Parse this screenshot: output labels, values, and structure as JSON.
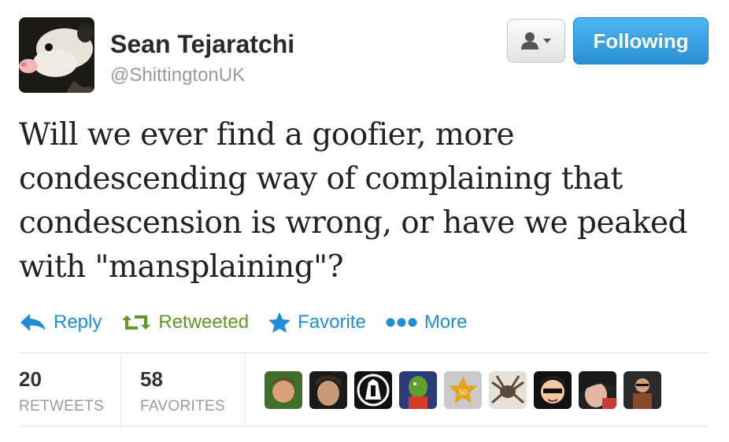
{
  "author": {
    "name": "Sean Tejaratchi",
    "handle": "@ShittingtonUK"
  },
  "follow_button": {
    "label": "Following"
  },
  "user_menu": {
    "icon": "person-dropdown-icon"
  },
  "tweet": {
    "lines": [
      "Will we ever find a goofier, more",
      "condescending way of complaining that",
      "condescension is wrong, or have we peaked",
      "with \"mansplaining\"?"
    ]
  },
  "actions": {
    "reply": {
      "label": "Reply",
      "icon": "reply-arrow-icon",
      "color": "#1f8ed8"
    },
    "retweet": {
      "label": "Retweeted",
      "icon": "retweet-icon",
      "color": "#609927"
    },
    "favorite": {
      "label": "Favorite",
      "icon": "star-icon",
      "color": "#1f8ed8"
    },
    "more": {
      "label": "More",
      "icon": "ellipsis-icon",
      "color": "#1f8ed8"
    }
  },
  "stats": {
    "retweets": {
      "count": "20",
      "label": "RETWEETS"
    },
    "favorites": {
      "count": "58",
      "label": "FAVORITES"
    }
  },
  "favoriters": [
    {
      "icon": "user-avatar-1"
    },
    {
      "icon": "user-avatar-2"
    },
    {
      "icon": "user-avatar-3"
    },
    {
      "icon": "user-avatar-4"
    },
    {
      "icon": "user-avatar-5"
    },
    {
      "icon": "user-avatar-6"
    },
    {
      "icon": "user-avatar-7"
    },
    {
      "icon": "user-avatar-8"
    },
    {
      "icon": "user-avatar-9"
    }
  ],
  "badge_text": "50"
}
